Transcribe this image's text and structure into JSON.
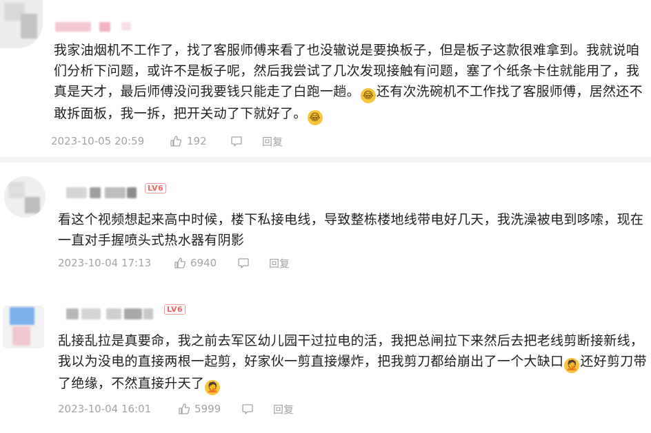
{
  "comments": [
    {
      "text": "我家油烟机不工作了，找了客服师傅来看了也没辙说是要换板子，但是板子这款很难拿到。我就说咱们分析下问题，或许不是板子呢，然后我尝试了几次发现接触有问题，塞了个纸条卡住就能用了，我真是天才，最后师傅没问我要钱只能走了白跑一趟。",
      "text2": "还有次洗碗机不工作找了客服师傅，居然还不敢拆面板，我一拆，把开关动了下就好了。",
      "emoji": "laugh-cry-emoji",
      "date": "2023-10-05 20:59",
      "likes": "192",
      "reply": "回复"
    },
    {
      "level": "LV6",
      "text": "看这个视频想起来高中时候，楼下私接电线，导致整栋楼地线带电好几天，我洗澡被电到哆嗦，现在一直对手握喷头式热水器有阴影",
      "date": "2023-10-04 17:13",
      "likes": "6940",
      "reply": "回复"
    },
    {
      "level": "LV6",
      "text": "乱接乱拉是真要命，我之前去军区幼儿园干过拉电的活，我把总闸拉下来然后去把老线剪断接新线，我以为没电的直接两根一起剪，好家伙一剪直接爆炸，把我剪刀都给崩出了一个大缺口",
      "text2": "还好剪刀带了绝缘，不然直接升天了",
      "emoji": "facepalm-emoji",
      "date": "2023-10-04 16:01",
      "likes": "5999",
      "reply": "回复"
    }
  ],
  "icons": {
    "like": "thumbs-up-icon",
    "comment": "comment-bubble-icon"
  },
  "colors": {
    "text": "#1f1f1f",
    "meta": "#a3a3a3",
    "level_badge": "#f2665f"
  }
}
